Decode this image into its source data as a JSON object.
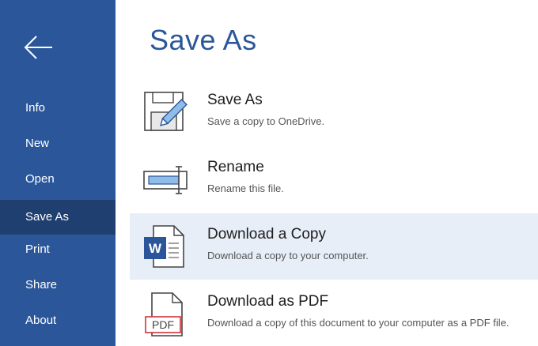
{
  "sidebar": {
    "back_icon": "arrow-left-icon",
    "items": [
      {
        "label": "Info",
        "active": false
      },
      {
        "label": "New",
        "active": false
      },
      {
        "label": "Open",
        "active": false
      },
      {
        "label": "Save As",
        "active": true
      },
      {
        "label": "Print",
        "active": false
      },
      {
        "label": "Share",
        "active": false
      },
      {
        "label": "About",
        "active": false
      }
    ]
  },
  "main": {
    "title": "Save As",
    "options": [
      {
        "title": "Save As",
        "description": "Save a copy to OneDrive.",
        "icon": "save-as-icon",
        "selected": false
      },
      {
        "title": "Rename",
        "description": "Rename this file.",
        "icon": "rename-icon",
        "selected": false
      },
      {
        "title": "Download a Copy",
        "description": "Download a copy to your computer.",
        "icon": "word-document-icon",
        "selected": true
      },
      {
        "title": "Download as PDF",
        "description": "Download a copy of this document to your computer as a PDF file.",
        "icon": "pdf-document-icon",
        "selected": false,
        "icon_text": "PDF"
      }
    ]
  },
  "colors": {
    "sidebar_bg": "#2b579a",
    "sidebar_active": "#1f3f70",
    "title_blue": "#2b579a",
    "selected_bg": "#e7eef8",
    "pdf_red": "#d13438"
  }
}
